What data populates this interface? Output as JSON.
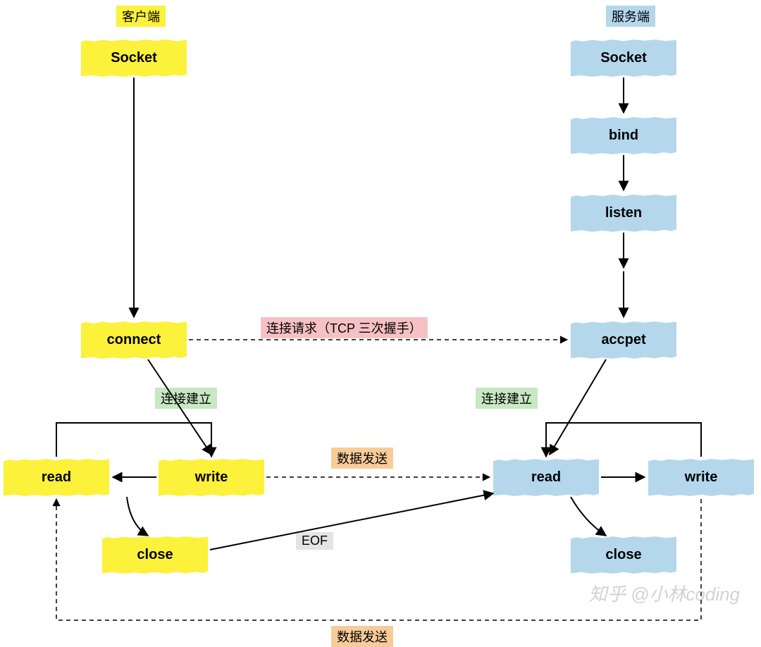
{
  "titles": {
    "client": "客户端",
    "server": "服务端"
  },
  "client": {
    "socket": "Socket",
    "connect": "connect",
    "read": "read",
    "write": "write",
    "close": "close"
  },
  "server": {
    "socket": "Socket",
    "bind": "bind",
    "listen": "listen",
    "accept": "accpet",
    "read": "read",
    "write": "write",
    "close": "close"
  },
  "labels": {
    "tcp_handshake": "连接请求（TCP 三次握手）",
    "conn_established_client": "连接建立",
    "conn_established_server": "连接建立",
    "data_send_top": "数据发送",
    "data_send_bottom": "数据发送",
    "eof": "EOF"
  },
  "watermark": "知乎 @小林coding",
  "colors": {
    "yellow": "#fcf13b",
    "blue": "#b4d7ec",
    "pink": "#f6c1c4",
    "green": "#c7e8c2",
    "orange": "#f7cc9a",
    "grey": "#e4e4e4"
  }
}
